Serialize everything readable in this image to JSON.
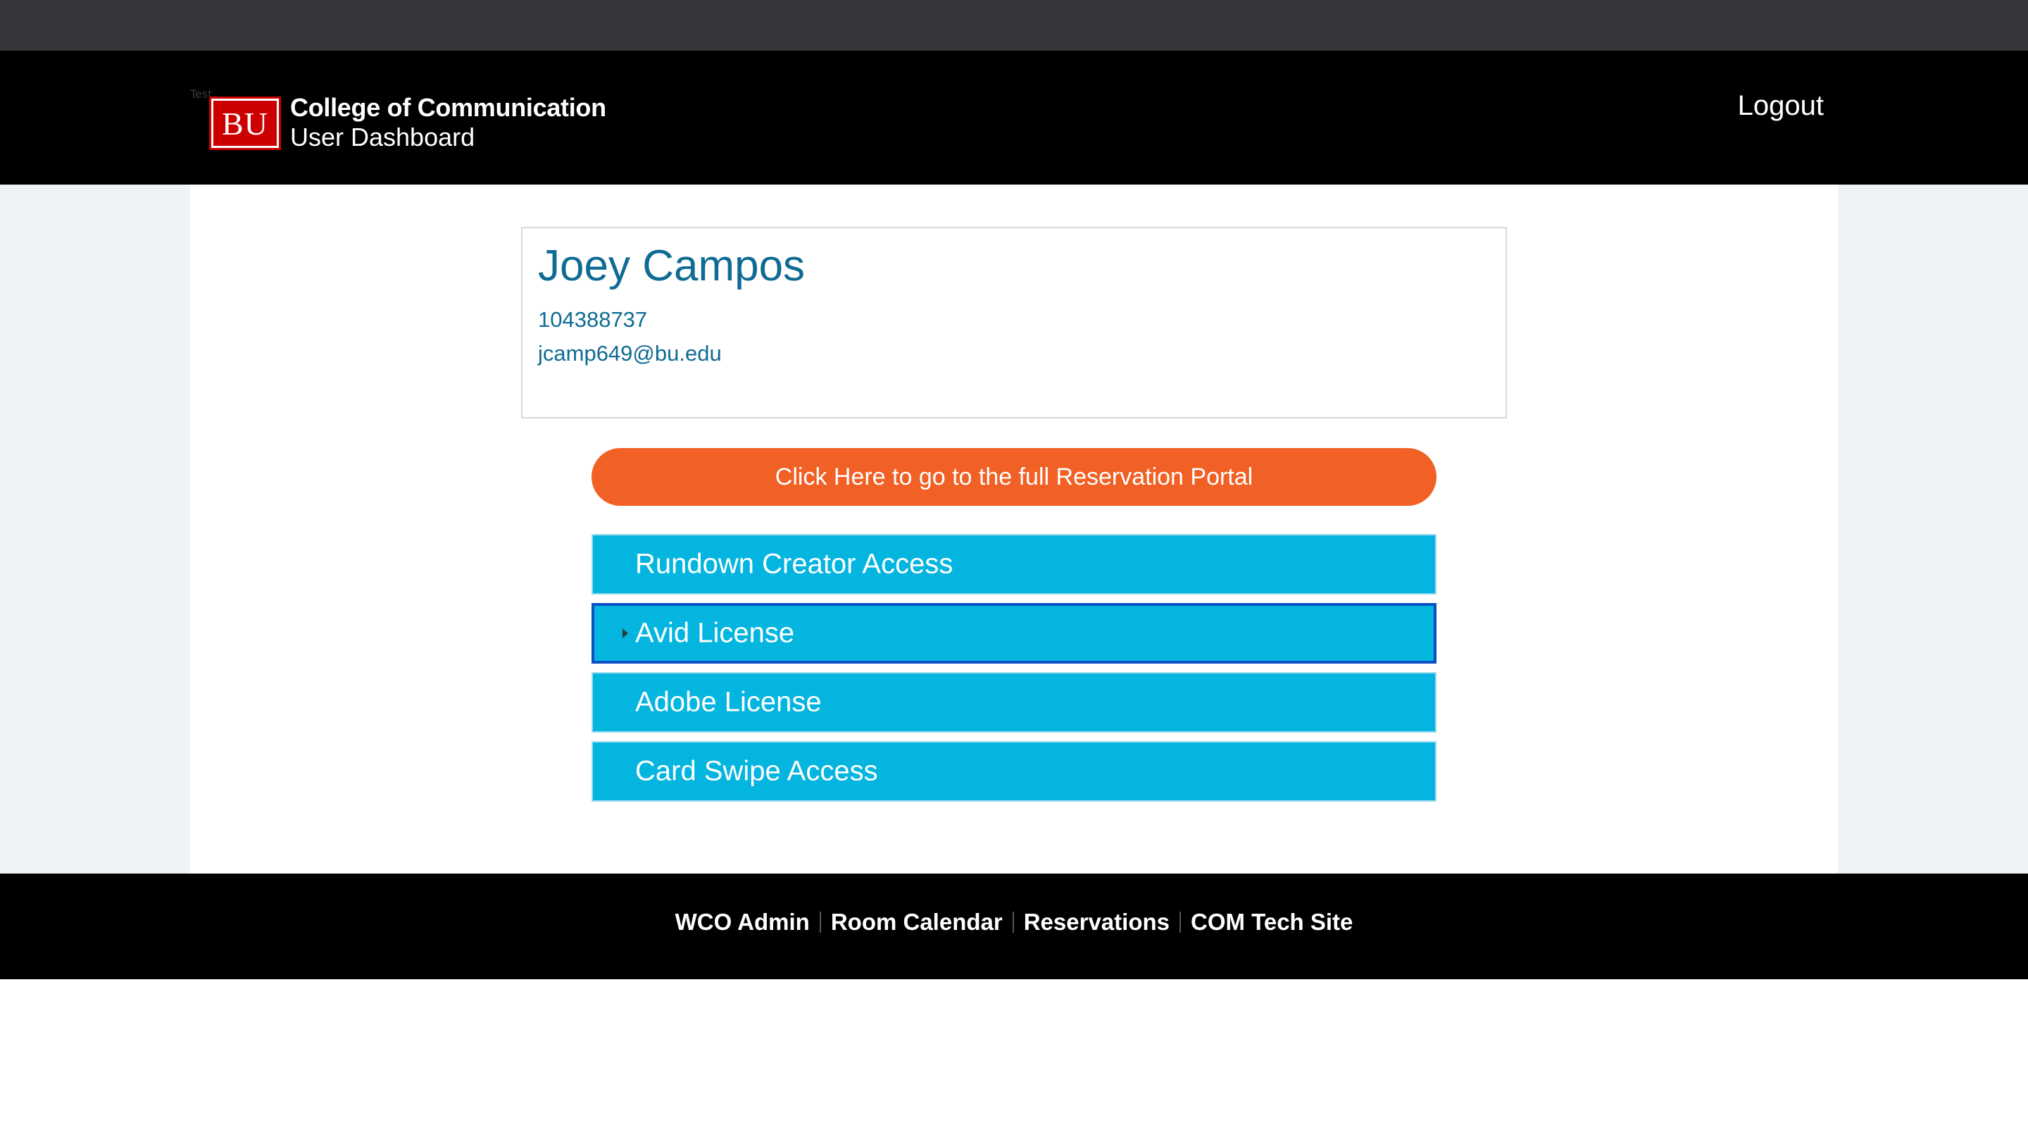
{
  "header": {
    "tab_hint": "Test",
    "logo_text": "BU",
    "brand_title": "College of Communication",
    "brand_subtitle": "User Dashboard",
    "logout_label": "Logout"
  },
  "profile": {
    "name": "Joey Campos",
    "id": "104388737",
    "email": "jcamp649@bu.edu"
  },
  "portal_button_label": "Click Here to go to the full Reservation Portal",
  "access_items": [
    {
      "label": "Rundown Creator Access"
    },
    {
      "label": "Avid License",
      "selected": true
    },
    {
      "label": "Adobe License"
    },
    {
      "label": "Card Swipe Access"
    }
  ],
  "footer": {
    "links": [
      {
        "label": "WCO Admin"
      },
      {
        "label": "Room Calendar"
      },
      {
        "label": "Reservations"
      },
      {
        "label": "COM Tech Site"
      }
    ]
  },
  "colors": {
    "header_bg": "#000000",
    "browser_strip": "#36373b",
    "logo_red": "#cc0000",
    "name_blue": "#0f6b93",
    "portal_orange": "#f16025",
    "access_cyan": "#04b5df",
    "selected_border": "#0a4fc4"
  }
}
